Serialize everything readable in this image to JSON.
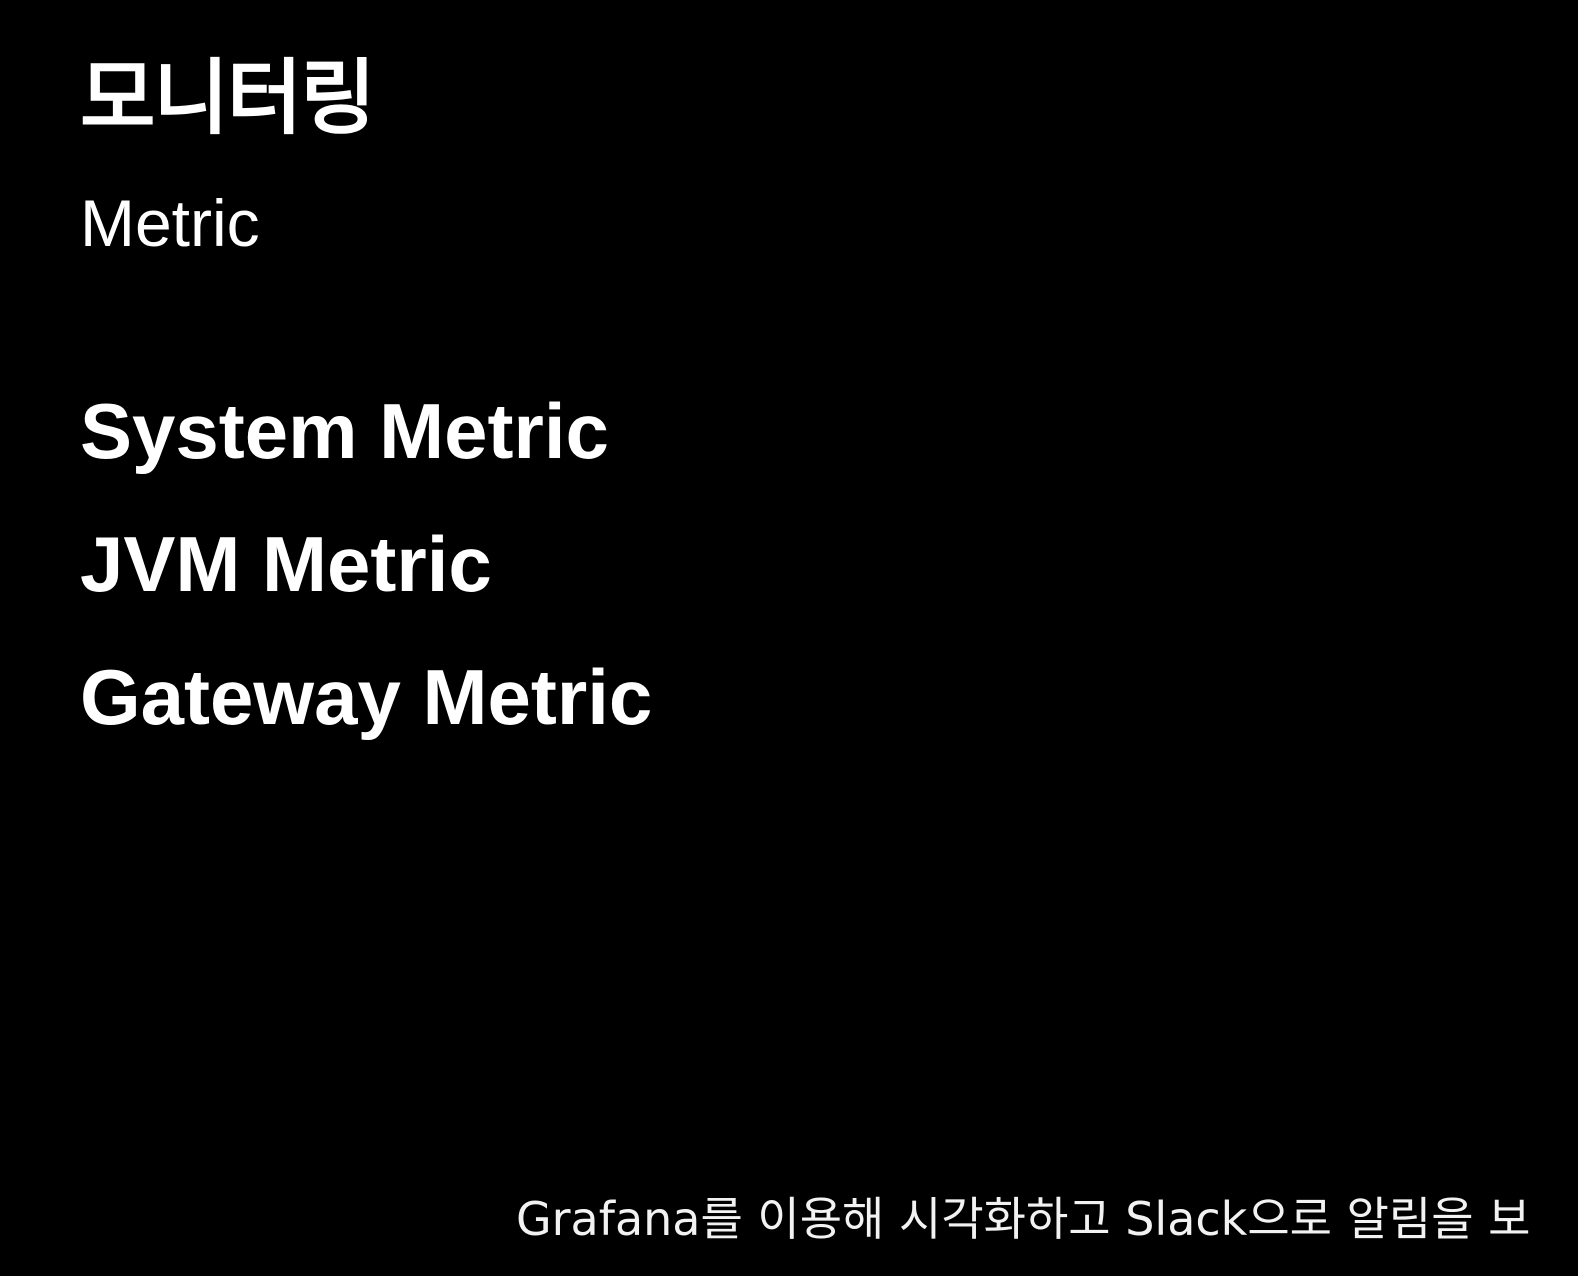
{
  "slide": {
    "title": "모니터링",
    "subtitle": "Metric",
    "items": [
      {
        "label": "System Metric"
      },
      {
        "label": "JVM Metric"
      },
      {
        "label": "Gateway Metric"
      }
    ]
  },
  "caption": {
    "text": "Grafana를 이용해 시각화하고 Slack으로 알림을 보"
  },
  "colors": {
    "background": "#000000",
    "text": "#ffffff"
  }
}
